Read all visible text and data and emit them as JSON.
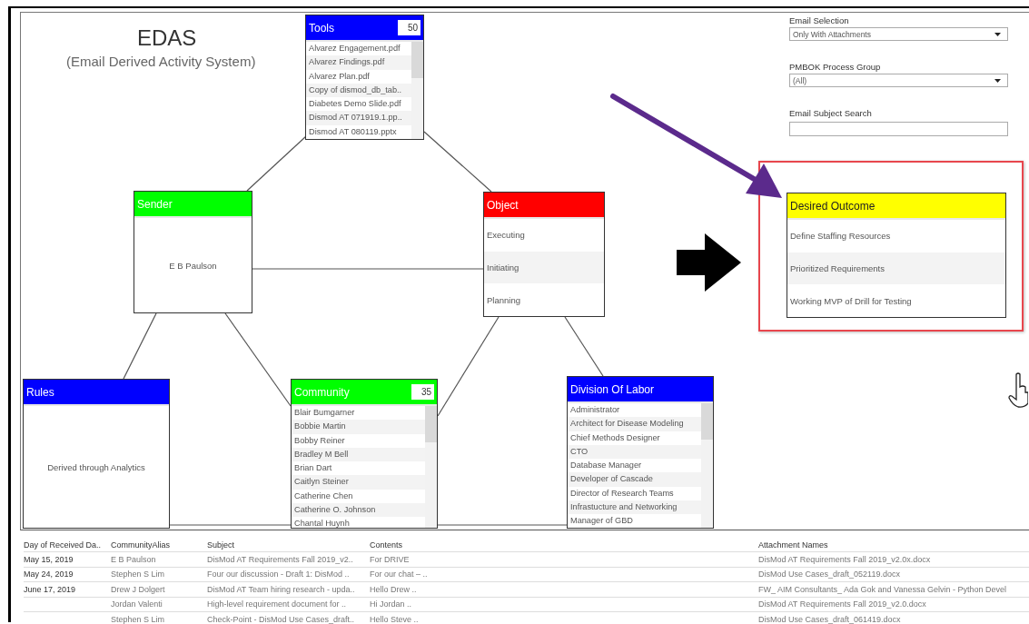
{
  "title": "EDAS",
  "subtitle": "(Email Derived Activity System)",
  "nodes": [
    {
      "kind": "list",
      "title": "Tools",
      "color": "#0000ff",
      "count": "50",
      "items": [
        "Alvarez Engagement.pdf",
        "Alvarez Findings.pdf",
        "Alvarez Plan.pdf",
        "Copy of dismod_db_tab..",
        "Diabetes Demo Slide.pdf",
        "Dismod AT 071919.1.pp..",
        "Dismod AT 080119.pptx"
      ]
    },
    {
      "kind": "text",
      "title": "Sender",
      "color": "#00ff00",
      "text": "E B Paulson"
    },
    {
      "kind": "rows",
      "title": "Object",
      "color": "#ff0000",
      "items": [
        "Executing",
        "Initiating",
        "Planning"
      ]
    },
    {
      "kind": "text",
      "title": "Rules",
      "color": "#0000ff",
      "text": "Derived through Analytics"
    },
    {
      "kind": "list",
      "title": "Community",
      "color": "#00ff00",
      "count": "35",
      "items": [
        "Blair Bumgarner",
        "Bobbie Martin",
        "Bobby Reiner",
        "Bradley M Bell",
        "Brian Dart",
        "Caitlyn Steiner",
        "Catherine Chen",
        "Catherine O. Johnson",
        "Chantal Huynh"
      ]
    },
    {
      "kind": "list",
      "title": "Division Of Labor",
      "color": "#0000ff",
      "items": [
        "Administrator",
        "Architect for Disease Modeling",
        "Chief Methods Designer",
        "CTO",
        "Database Manager",
        "Developer of Cascade",
        "Director of Research Teams",
        "Infrastucture and Networking",
        "Manager of GBD"
      ]
    },
    {
      "kind": "rows",
      "title": "Desired Outcome",
      "color": "#ffff00",
      "highlighted": true,
      "items": [
        "Define Staffing Resources",
        "Prioritized Requirements",
        "Working MVP of Drill for Testing"
      ]
    }
  ],
  "filters": [
    {
      "kind": "dropdown",
      "label": "Email Selection",
      "value": "Only With Attachments"
    },
    {
      "kind": "dropdown",
      "label": "PMBOK Process Group",
      "value": "(All)"
    },
    {
      "kind": "search",
      "label": "Email Subject Search"
    }
  ],
  "table": {
    "columns": [
      "Day of Received Da..",
      "CommunityAlias",
      "Subject",
      "Contents",
      "Attachment Names"
    ],
    "rows": [
      {
        "cells": [
          "May 15, 2019",
          "E B Paulson",
          "DisMod AT Requirements Fall 2019_v2..",
          "For DRIVE",
          "DisMod AT Requirements Fall 2019_v2.0x.docx"
        ]
      },
      {
        "cells": [
          "May 24, 2019",
          "Stephen S Lim",
          "Four our discussion - Draft 1:  DisMod ..",
          "For our chat – ..",
          "DisMod Use Cases_draft_052119.docx"
        ]
      },
      {
        "cells": [
          "June 17, 2019",
          "Drew J Dolgert",
          "DisMod AT Team hiring research - upda..",
          "Hello Drew ..",
          "FW_ AIM Consultants_ Ada Gok and Vanessa Gelvin - Python Devel"
        ]
      },
      {
        "cells": [
          "",
          "Jordan Valenti",
          "High-level requirement document for ..",
          "Hi Jordan ..",
          "DisMod AT Requirements Fall 2019_v2.0.docx"
        ]
      },
      {
        "cells": [
          "",
          "Stephen S Lim",
          "Check-Point - DisMod Use Cases_draft..",
          "Hello Steve ..",
          "DisMod Use Cases_draft_061419.docx"
        ]
      }
    ]
  }
}
